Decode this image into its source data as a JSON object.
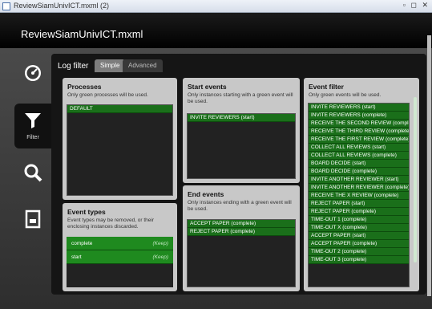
{
  "window": {
    "title": "ReviewSiamUnivICT.mxml (2)",
    "controls": "▫ ◻ ✕"
  },
  "app": {
    "title": "ReviewSiamUnivICT.mxml"
  },
  "sidebar": {
    "items": [
      {
        "icon": "dashboard-icon",
        "label": ""
      },
      {
        "icon": "filter-icon",
        "label": "Filter",
        "active": true
      },
      {
        "icon": "magnifier-icon",
        "label": ""
      },
      {
        "icon": "document-icon",
        "label": ""
      }
    ]
  },
  "panel": {
    "heading": "Log filter",
    "tabs": [
      {
        "label": "Simple",
        "active": true
      },
      {
        "label": "Advanced",
        "active": false
      }
    ]
  },
  "processes": {
    "title": "Processes",
    "description": "Only green processes will be used.",
    "items": [
      "DEFAULT"
    ]
  },
  "start_events": {
    "title": "Start events",
    "description": "Only instances starting with a green event will be used.",
    "items": [
      "INVITE REVIEWERS (start)"
    ]
  },
  "end_events": {
    "title": "End events",
    "description": "Only instances ending with a green event will be used.",
    "items": [
      "ACCEPT PAPER (complete)",
      "REJECT PAPER (complete)"
    ]
  },
  "event_types": {
    "title": "Event types",
    "description": "Event types may be removed, or their enclosing instances discarded.",
    "items": [
      {
        "name": "complete",
        "action": "(Keep)"
      },
      {
        "name": "start",
        "action": "(Keep)"
      }
    ]
  },
  "event_filter": {
    "title": "Event filter",
    "description": "Only green events will be used.",
    "items": [
      "INVITE REVIEWERS (start)",
      "INVITE REVIEWERS (complete)",
      "RECEIVE THE SECOND REVIEW (complet",
      "RECEIVE THE THIRD REVIEW (complete)",
      "RECEIVE THE FIRST REVIEW (complete)",
      "COLLECT ALL REVIEWS (start)",
      "COLLECT ALL REVIEWS (complete)",
      "BOARD DECIDE (start)",
      "BOARD DECIDE (complete)",
      "INVITE ANOTHER REVIEWER (start)",
      "INVITE ANOTHER REVIEWER (complete)",
      "RECEIVE THE X REVIEW (complete)",
      "REJECT PAPER (start)",
      "REJECT PAPER (complete)",
      "TIME-OUT 1 (complete)",
      "TIME-OUT X (complete)",
      "ACCEPT PAPER (start)",
      "ACCEPT PAPER (complete)",
      "TIME-OUT 2 (complete)",
      "TIME-OUT 3 (complete)"
    ]
  },
  "colors": {
    "green": "#1a6f1a",
    "panel": "#c8c8c8",
    "background": "#2b2b2b"
  }
}
